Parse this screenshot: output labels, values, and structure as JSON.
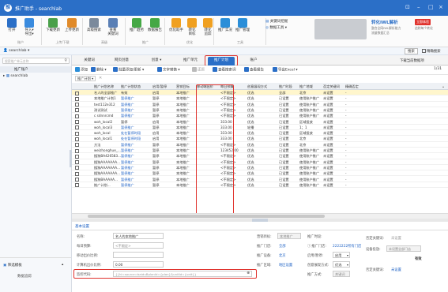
{
  "app": {
    "title": "推广助手 - searchlab",
    "win_controls": [
      "⊡",
      "–",
      "□",
      "×"
    ]
  },
  "ribbon": {
    "buttons": [
      {
        "label": "打开",
        "color": "#2b6fc7"
      },
      {
        "label": "导入▾\n导出▾",
        "color": "#3a8bde"
      },
      {
        "label": "下载更新",
        "color": "#4aa04a"
      },
      {
        "label": "上传更新",
        "color": "#e08a2a"
      },
      {
        "label": "高级搜索",
        "color": "#7b8a9c"
      },
      {
        "label": "查看\n关键词",
        "color": "#5a7fb5"
      },
      {
        "label": "推广趋势",
        "color": "#45a845"
      },
      {
        "label": "数据报告",
        "color": "#45a845"
      },
      {
        "label": "优化助手",
        "color": "#f0a020"
      },
      {
        "label": "转化\n目标",
        "color": "#f0a020"
      },
      {
        "label": "转化\n追踪",
        "color": "#f0a020"
      },
      {
        "label": "推广实况",
        "color": "#2b8ed8"
      },
      {
        "label": "推广管理",
        "color": "#2b8ed8"
      }
    ],
    "right_links": [
      "关键词挖掘",
      "数据工具 ▾"
    ],
    "groups": [
      "账户",
      "上传/下载",
      "高级",
      "推广",
      "优化",
      "工具"
    ],
    "promo_title": "转化IWL解析",
    "promo_badge": "立即体验",
    "promo_lines": [
      "整合全网IWL解析能力",
      "追踪每个转化",
      "流量数据汇总"
    ]
  },
  "subbar": {
    "account": "searchlab",
    "search_btn": "搜索",
    "toggle": "精确搜索"
  },
  "sidebar": {
    "search_placeholder": "搜索推广单元名称",
    "header": "推广账户",
    "tree_item": "searchlab",
    "footer_items": [
      "筛选模板",
      "数据追踪"
    ]
  },
  "tabs": [
    "关键词",
    "网页创意",
    "创意 ▾",
    "推广单元",
    "推广计划",
    "账户"
  ],
  "toolbar": {
    "items": [
      "添加",
      "删除",
      "批量添加/更新",
      "文字替换 ▾",
      "还原",
      "查看搜索词",
      "查看报告",
      "导出Excel ▾"
    ],
    "right": "下载当前数据项",
    "page": "1/31"
  },
  "filter": {
    "label": "推广计划 ▾"
  },
  "grid": {
    "columns": [
      "推广计划名称",
      "推广计划状态",
      "启用/暂停",
      "营销目标",
      "移动端出价",
      "每日预算",
      "创意展现方式",
      "推广时段",
      "推广地域",
      "否定关键词",
      "精确否定"
    ],
    "rows": [
      [
        "名人的全部推广",
        "有效",
        "启用",
        "本地推广",
        "",
        "<不限定>",
        "优选",
        "全部",
        "北京",
        "未设置",
        "-"
      ],
      [
        "本地推广计划1",
        "暂停推广",
        "暂停",
        "本地推广",
        "",
        "<不限定>",
        "优选",
        "已设置",
        "使用账户推广",
        "未设置",
        "-"
      ],
      [
        "test112e312",
        "暂停推广",
        "暂停",
        "本地推广",
        "",
        "<不限定>",
        "优选",
        "已设置",
        "使用账户推广",
        "未设置",
        "-"
      ],
      [
        "测试测试",
        "暂停推广",
        "暂停",
        "本地推广",
        "",
        "<不限定>",
        "优选",
        "已设置",
        "使用账户推广",
        "未设置",
        "-"
      ],
      [
        "c sdnnrcmd",
        "暂停推广",
        "暂停",
        "本地推广",
        "",
        "<不限定>",
        "优选",
        "已设置",
        "使用账户推广",
        "未设置",
        "-"
      ],
      [
        "woh_local2",
        "暂停",
        "启用",
        "本地推广",
        "",
        "333.00",
        "优选",
        "已设置",
        "区域投放",
        "未设置",
        "-"
      ],
      [
        "woh_local3",
        "暂停推广",
        "暂停",
        "本地推广",
        "",
        "333.00",
        "轮播",
        "已设置",
        "1；1",
        "未设置",
        "-"
      ],
      [
        "woh_local",
        "处在暂停时段",
        "启用",
        "本地推广",
        "",
        "333.00",
        "优选",
        "已设置",
        "区域投放",
        "未设置",
        "-"
      ],
      [
        "woh_local1",
        "处在暂停时段",
        "启用",
        "本地推广",
        "",
        "333.00",
        "优选",
        "已设置",
        "北京",
        "未设置",
        "-"
      ],
      [
        "方法",
        "暂停推广",
        "暂停",
        "本地推广",
        "",
        "<不限定>",
        "优选",
        "已设置",
        "北京",
        "未设置",
        "-"
      ],
      [
        "weizhonghue_...",
        "暂停推广",
        "暂停",
        "本地推广",
        "",
        "123452.00",
        "优选",
        "已设置",
        "使用账户推广",
        "未设置",
        "-"
      ],
      [
        "搜狗BA426583...",
        "暂停推广",
        "暂停",
        "本地推广",
        "",
        "<不限定>",
        "优选",
        "已设置",
        "使用账户推广",
        "未设置",
        "-"
      ],
      [
        "搜狗AAAAAAA...",
        "暂停推广",
        "暂停",
        "本地推广",
        "",
        "<不限定>",
        "优选",
        "已设置",
        "使用账户推广",
        "未设置",
        "-"
      ],
      [
        "搜狗AAAAAAA...",
        "暂停推广",
        "暂停",
        "本地推广",
        "",
        "<不限定>",
        "优选",
        "已设置",
        "使用账户推广",
        "未设置",
        "-"
      ],
      [
        "搜狗AAAAAAA...",
        "暂停推广",
        "暂停",
        "本地推广",
        "",
        "<不限定>",
        "优选",
        "已设置",
        "使用账户推广",
        "未设置",
        "-"
      ],
      [
        "搜狗BAAAAA...",
        "暂停推广",
        "暂停",
        "本地推广",
        "",
        "<不限定>",
        "优选",
        "已设置",
        "使用账户推广",
        "未设置",
        "-"
      ],
      [
        "推广计划...",
        "暂停推广",
        "暂停",
        "本地推广",
        "",
        "<不限定>",
        "优选",
        "已设置",
        "使用账户推广",
        "未设置",
        "-"
      ]
    ]
  },
  "detail": {
    "tab": "基本设置",
    "labels": {
      "name": "名称:",
      "budget": "每日预算:",
      "mobile_bid": "移动出价比例:",
      "pc_bid": "计算机出价比例:",
      "monitor": "监控代码:",
      "target": "营销目标:",
      "promo_shop": "推广门店:",
      "device": "推广设备:",
      "region": "推广区域:",
      "schedule": "推广时段:",
      "shop_count": "推广门店:",
      "start_pause": "启用/暂停:",
      "creative_mode": "创意展现方式:",
      "pc_price": "推广方式:",
      "neg_kw": "否定关键词:",
      "device_enable": "设备投放:",
      "neg_exact": "否定关键词:",
      "extra": "推广时间:"
    },
    "values": {
      "name": "名人的本地推广",
      "budget": "<不限定>",
      "mobile_bid": "",
      "pc_bid": "0.00",
      "monitor": "{{hl=source=baiduBplanId={plan}&unitId={unit}}",
      "target": "本地推广",
      "promo_shop": "全部",
      "device": "北京",
      "region": "地区设置",
      "schedule": "全部",
      "shop_count": "2222222所有门店",
      "start_pause": "启用",
      "creative_mode": "优选",
      "pc_price": "关键词",
      "neg_kw": "未设置",
      "device_enable": "未设置全部门店",
      "status": "有效",
      "neg_exact": "未设置"
    }
  }
}
